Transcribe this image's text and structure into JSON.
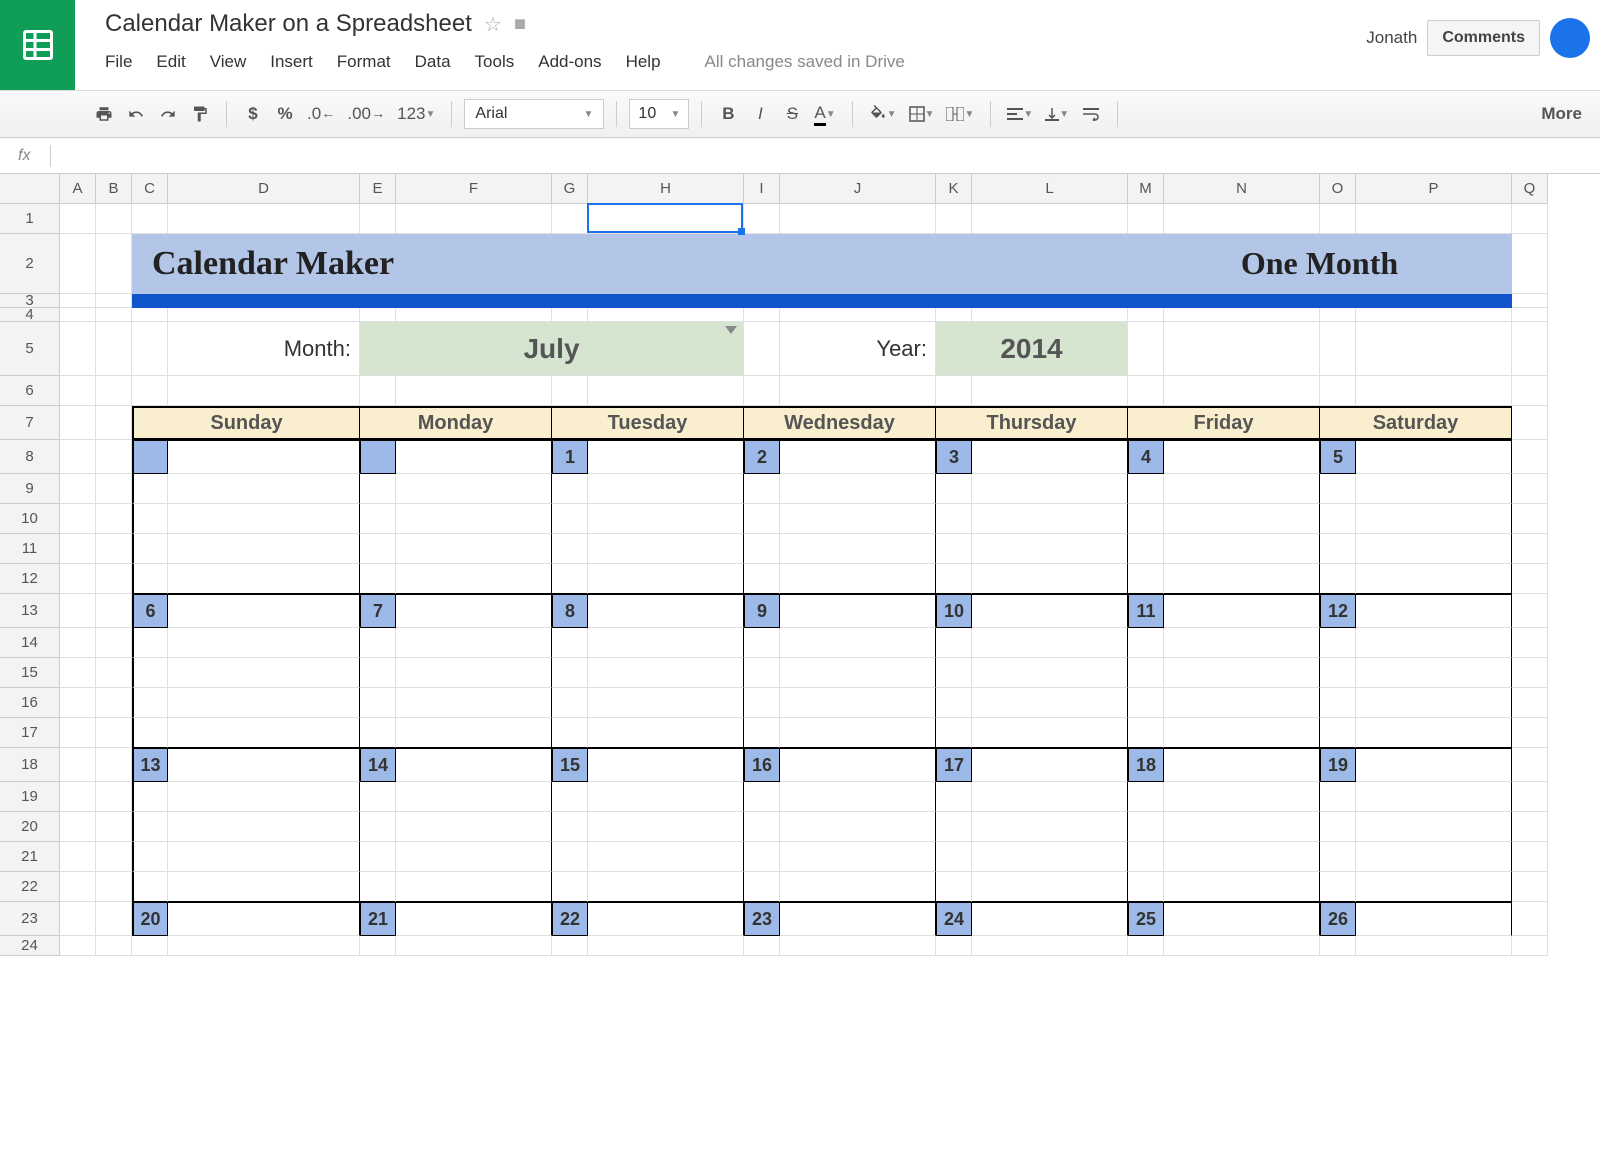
{
  "header": {
    "title": "Calendar Maker on a Spreadsheet",
    "user": "Jonath",
    "comments_btn": "Comments",
    "save_status": "All changes saved in Drive"
  },
  "menu": [
    "File",
    "Edit",
    "View",
    "Insert",
    "Format",
    "Data",
    "Tools",
    "Add-ons",
    "Help"
  ],
  "toolbar": {
    "font": "Arial",
    "size": "10",
    "more": "More"
  },
  "formula_bar": {
    "fx": "fx"
  },
  "columns": [
    "A",
    "B",
    "C",
    "D",
    "E",
    "F",
    "G",
    "H",
    "I",
    "J",
    "K",
    "L",
    "M",
    "N",
    "O",
    "P",
    "Q"
  ],
  "rows": [
    "1",
    "2",
    "3",
    "4",
    "5",
    "6",
    "7",
    "8",
    "9",
    "10",
    "11",
    "12",
    "13",
    "14",
    "15",
    "16",
    "17",
    "18",
    "19",
    "20",
    "21",
    "22",
    "23",
    "24"
  ],
  "sheet": {
    "banner_title": "Calendar Maker",
    "banner_right": "One Month",
    "month_label": "Month:",
    "month_value": "July",
    "year_label": "Year:",
    "year_value": "2014",
    "days": [
      "Sunday",
      "Monday",
      "Tuesday",
      "Wednesday",
      "Thursday",
      "Friday",
      "Saturday"
    ],
    "weeks": [
      [
        "",
        "",
        "1",
        "2",
        "3",
        "4",
        "5"
      ],
      [
        "6",
        "7",
        "8",
        "9",
        "10",
        "11",
        "12"
      ],
      [
        "13",
        "14",
        "15",
        "16",
        "17",
        "18",
        "19"
      ],
      [
        "20",
        "21",
        "22",
        "23",
        "24",
        "25",
        "26"
      ]
    ]
  }
}
